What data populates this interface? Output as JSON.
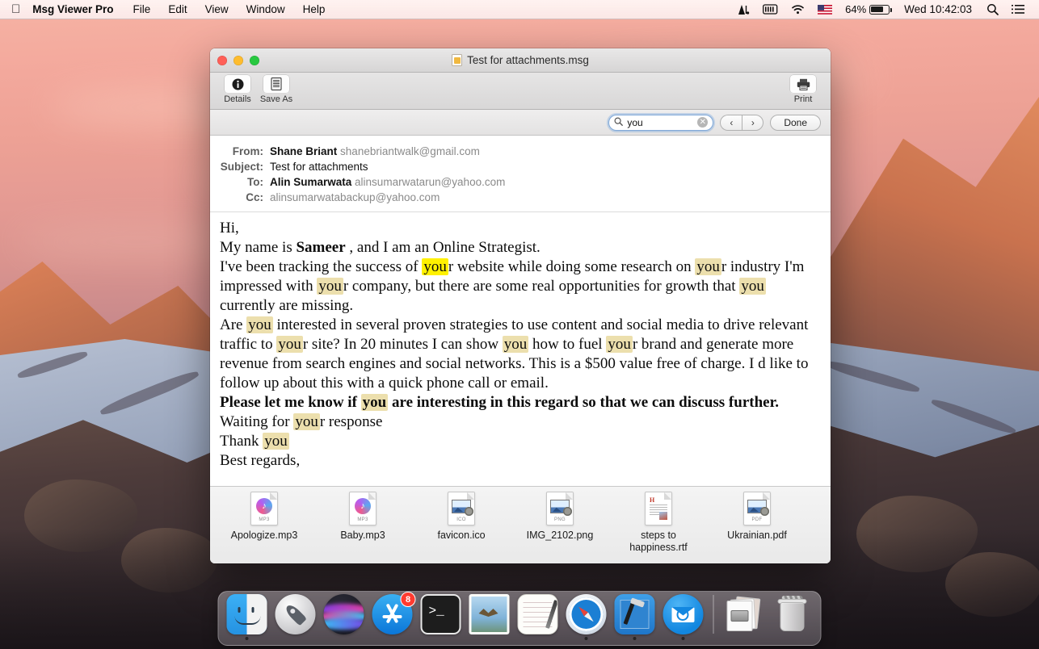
{
  "menubar": {
    "apple_icon": "apple-icon",
    "app_name": "Msg Viewer Pro",
    "menus": [
      "File",
      "Edit",
      "View",
      "Window",
      "Help"
    ],
    "status": {
      "adobe_icon": "adobe-icon",
      "battery_meter_icon": "battery-meter-icon",
      "wifi_icon": "wifi-icon",
      "flag_icon": "us-flag-icon",
      "battery_percent": "64%",
      "clock": "Wed 10:42:03",
      "search_icon": "search-icon",
      "notification_center_icon": "list-icon"
    }
  },
  "window": {
    "title": "Test for attachments.msg",
    "title_icon": "msg-document-icon",
    "traffic_lights": {
      "close": "close-button",
      "minimize": "minimize-button",
      "zoom": "zoom-button"
    },
    "toolbar": {
      "details_label": "Details",
      "details_icon": "info-icon",
      "save_as_label": "Save As",
      "save_as_icon": "save-icon",
      "print_label": "Print",
      "print_icon": "printer-icon"
    },
    "findbar": {
      "search_icon": "search-icon",
      "query": "you",
      "placeholder": "Search",
      "clear_icon": "clear-icon",
      "prev_icon": "‹",
      "next_icon": "›",
      "done_label": "Done"
    },
    "headers": [
      {
        "label": "From:",
        "name": "Shane Briant",
        "email": "shanebriantwalk@gmail.com"
      },
      {
        "label": "Subject:",
        "name": "Test for attachments",
        "email": ""
      },
      {
        "label": "To:",
        "name": "Alin Sumarwata",
        "email": "alinsumarwatarun@yahoo.com"
      },
      {
        "label": "Cc:",
        "name": "",
        "email": "alinsumarwatabackup@yahoo.com"
      }
    ],
    "body": {
      "greeting": "Hi,",
      "line_name_pre": "My name is ",
      "line_name_bold": "Sameer",
      "line_name_post": " , and I am an Online Strategist.",
      "p1_a": "I've been tracking the success of ",
      "p1_hl1": "you",
      "p1_b": "r website while doing some research on ",
      "p1_hl2": "you",
      "p1_c": "r industry I'm impressed with ",
      "p1_hl3": "you",
      "p1_d": "r company, but there are some real opportunities for growth that ",
      "p1_hl4": "you",
      "p1_e": " currently are missing.",
      "p2_a": "Are ",
      "p2_hl1": "you",
      "p2_b": " interested in several proven strategies to use content and social media to drive relevant traffic to ",
      "p2_hl2": "you",
      "p2_c": "r site? In 20 minutes I can show ",
      "p2_hl3": "you",
      "p2_d": " how to fuel ",
      "p2_hl4": "you",
      "p2_e": "r brand and generate more revenue from search engines and social networks. This is a $500 value free of charge. I d like to follow up about this with a quick phone call or email.",
      "p3_a": "Please let me know if ",
      "p3_hl1": "you",
      "p3_b": " are interesting in this regard so that we can discuss further.",
      "p4_a": "Waiting for ",
      "p4_hl1": "you",
      "p4_b": "r response",
      "p5_a": "Thank ",
      "p5_hl1": "you",
      "p6": "Best regards,"
    },
    "attachments": [
      {
        "name": "Apologize.mp3",
        "ext": "MP3",
        "icon": "music-file-icon"
      },
      {
        "name": "Baby.mp3",
        "ext": "MP3",
        "icon": "music-file-icon"
      },
      {
        "name": "favicon.ico",
        "ext": "ICO",
        "icon": "image-file-icon"
      },
      {
        "name": "IMG_2102.png",
        "ext": "PNG",
        "icon": "image-file-icon"
      },
      {
        "name": "steps to happiness.rtf",
        "ext": "RTF",
        "icon": "rtf-file-icon"
      },
      {
        "name": "Ukrainian.pdf",
        "ext": "PDF",
        "icon": "image-file-icon"
      }
    ]
  },
  "dock": {
    "apps": [
      {
        "name": "Finder",
        "icon": "finder-icon",
        "running": true,
        "badge": ""
      },
      {
        "name": "Launchpad",
        "icon": "launchpad-icon",
        "running": false,
        "badge": ""
      },
      {
        "name": "Siri",
        "icon": "siri-icon",
        "running": false,
        "badge": ""
      },
      {
        "name": "App Store",
        "icon": "app-store-icon",
        "running": false,
        "badge": "8"
      },
      {
        "name": "Terminal",
        "icon": "terminal-icon",
        "running": false,
        "badge": ""
      },
      {
        "name": "Mail",
        "icon": "mail-stamp-icon",
        "running": false,
        "badge": ""
      },
      {
        "name": "Notes",
        "icon": "notes-icon",
        "running": false,
        "badge": ""
      },
      {
        "name": "Safari",
        "icon": "safari-icon",
        "running": true,
        "badge": ""
      },
      {
        "name": "Xcode",
        "icon": "xcode-icon",
        "running": true,
        "badge": ""
      },
      {
        "name": "Msg Viewer Pro",
        "icon": "msg-viewer-icon",
        "running": true,
        "badge": ""
      }
    ],
    "extras": [
      {
        "name": "Downloads",
        "icon": "downloads-stack-icon"
      },
      {
        "name": "Trash",
        "icon": "trash-icon"
      }
    ]
  },
  "colors": {
    "highlight_current": "#fff100",
    "highlight_other": "#ecdfad",
    "badge": "#ff3b30",
    "accent_blue": "#1287e0"
  }
}
